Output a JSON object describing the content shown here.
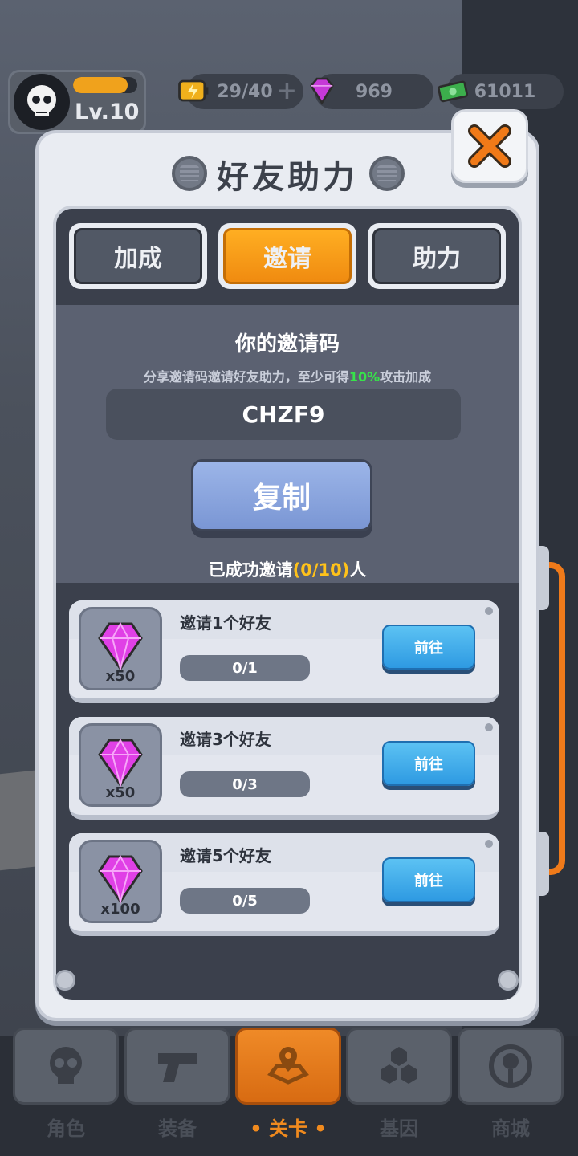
{
  "player": {
    "level": "Lv.10",
    "exp_fraction": 0.85
  },
  "resources": {
    "energy": "29/40",
    "gems": "969",
    "cash": "61011"
  },
  "dialog": {
    "title": "好友助力",
    "tabs": [
      {
        "label": "加成",
        "active": false
      },
      {
        "label": "邀请",
        "active": true
      },
      {
        "label": "助力",
        "active": false
      }
    ],
    "invite": {
      "title": "你的邀请码",
      "desc_prefix": "分享邀请码邀请好友助力，至少可得",
      "desc_highlight": "10%",
      "desc_suffix": "攻击加成",
      "code": "CHZF9",
      "copy_label": "复制",
      "invited_prefix": "已成功邀请",
      "invited_count": "(0/10)",
      "invited_suffix": "人"
    },
    "tasks": [
      {
        "name": "邀请1个好友",
        "reward_qty": "x50",
        "progress": "0/1",
        "progress_fraction": 0,
        "button": "前往"
      },
      {
        "name": "邀请3个好友",
        "reward_qty": "x50",
        "progress": "0/3",
        "progress_fraction": 0,
        "button": "前往"
      },
      {
        "name": "邀请5个好友",
        "reward_qty": "x100",
        "progress": "0/5",
        "progress_fraction": 0,
        "button": "前往"
      }
    ]
  },
  "nav": [
    {
      "label": "角色",
      "icon": "skull-icon",
      "active": false
    },
    {
      "label": "装备",
      "icon": "gun-icon",
      "active": false
    },
    {
      "label": "• 关卡 •",
      "icon": "map-pin-icon",
      "active": true
    },
    {
      "label": "基因",
      "icon": "hexagons-icon",
      "active": false
    },
    {
      "label": "商城",
      "icon": "shop-icon",
      "active": false
    }
  ],
  "colors": {
    "accent_orange": "#f08b10",
    "highlight_green": "#37e24a",
    "highlight_yellow": "#ffc21a",
    "button_blue": "#2e9ae2"
  }
}
